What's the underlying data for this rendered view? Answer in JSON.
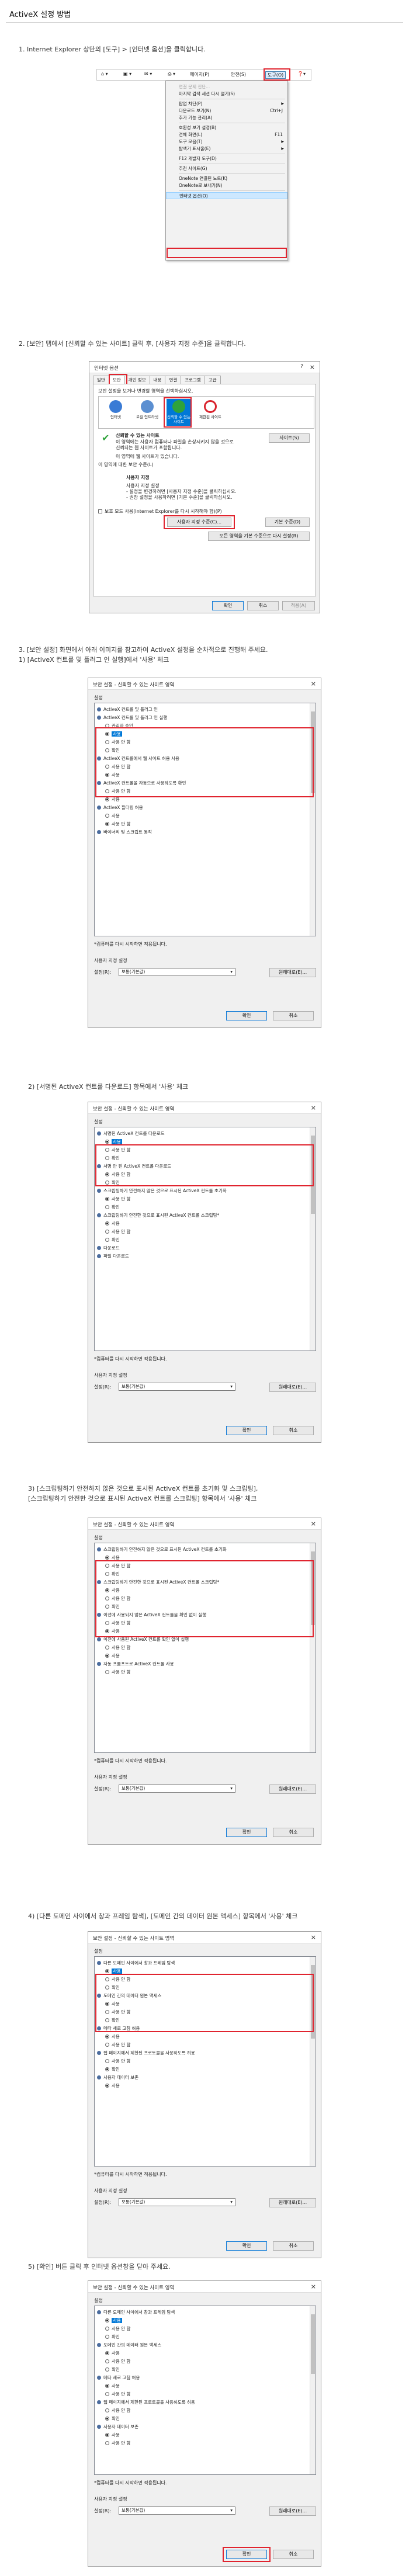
{
  "page": {
    "title": "ActiveX 설정 방법"
  },
  "steps": [
    "1. Internet Explorer 상단의 [도구] > [인터넷 옵션]을 클릭합니다.",
    "2. [보안] 탭에서 [신뢰할 수 있는 사이트] 클릭 후, [사용자 지정 수준]을 클릭합니다.",
    "3. [보안 설정] 화면에서 아래 이미지를 참고하여 ActiveX 설정을 순차적으로 진행해 주세요.\n   1) [ActiveX 컨트롤 및 플러그 인 실행]에서 '사용' 체크",
    "2) [서명된 ActiveX 컨트롤 다운로드] 항목에서 '사용' 체크",
    "3) [스크립팅하기 안전하지 않은 것으로 표시된 ActiveX 컨트롤 초기화 및 스크립팅],\n    [스크립팅하기 안전한 것으로 표시된 ActiveX 컨트롤 스크립팅] 항목에서 '사용' 체크",
    "4) [다른 도메인 사이에서 창과 프레임 탐색], [도메인 간의 데이터 원본 액세스] 항목에서 '사용' 체크",
    "5) [확인] 버튼 클릭 후 인터넷 옵션창을 닫아 주세요."
  ],
  "toolbar": {
    "items": [
      "페이지(P)",
      "안전(S)",
      "도구(O)"
    ],
    "active": "도구(O)"
  },
  "tools_menu": {
    "items": [
      {
        "label": "연결 문제 진단...",
        "shortcut": "",
        "disabled": true
      },
      {
        "label": "마지막 검색 세션 다시 열기(S)",
        "shortcut": "",
        "disabled": false
      },
      {
        "label": "",
        "sep": true
      },
      {
        "label": "팝업 차단(P)",
        "shortcut": "",
        "disabled": false,
        "arrow": true
      },
      {
        "label": "다운로드 보기(N)",
        "shortcut": "Ctrl+J",
        "disabled": false
      },
      {
        "label": "추가 기능 관리(A)",
        "shortcut": "",
        "disabled": false
      },
      {
        "label": "",
        "sep": true
      },
      {
        "label": "호환성 보기 설정(B)",
        "shortcut": "",
        "disabled": false
      },
      {
        "label": "전체 화면(L)",
        "shortcut": "F11",
        "disabled": false
      },
      {
        "label": "도구 모음(T)",
        "shortcut": "",
        "disabled": false,
        "arrow": true
      },
      {
        "label": "탐색기 표시줄(E)",
        "shortcut": "",
        "disabled": false,
        "arrow": true
      },
      {
        "label": "",
        "sep": true
      },
      {
        "label": "F12 개발자 도구(D)",
        "shortcut": "",
        "disabled": false
      },
      {
        "label": "",
        "sep": true
      },
      {
        "label": "추천 사이트(G)",
        "shortcut": "",
        "disabled": false
      },
      {
        "label": "",
        "sep": true
      },
      {
        "label": "OneNote 연결된 노트(K)",
        "shortcut": "",
        "disabled": false
      },
      {
        "label": "OneNote로 보내기(N)",
        "shortcut": "",
        "disabled": false
      },
      {
        "label": "",
        "sep": true
      },
      {
        "label": "인터넷 옵션(O)",
        "shortcut": "",
        "disabled": false,
        "highlight": true
      }
    ]
  },
  "internet_options": {
    "title": "인터넷 옵션",
    "help": "?",
    "close": "×",
    "tabs": [
      "일반",
      "보안",
      "개인 정보",
      "내용",
      "연결",
      "프로그램",
      "고급"
    ],
    "active_tab": "보안",
    "prompt": "보안 설정을 보거나 변경할 영역을 선택하십시오.",
    "zones": [
      {
        "label": "인터넷",
        "color": "#3a7bd5"
      },
      {
        "label": "로컬 인트라넷",
        "color": "#5b8fd1"
      },
      {
        "label": "신뢰할 수 있는 사이트",
        "color": "#2fa33b"
      },
      {
        "label": "제한된 사이트",
        "color": "#d9232d"
      }
    ],
    "selected_zone": "신뢰할 수 있는 사이트",
    "zone_heading": "신뢰할 수 있는 사이트",
    "zone_desc": "이 영역에는 사용자 컴퓨터나 파일을 손상시키지 않을 것으로 신뢰되는 웹 사이트가 포함됩니다.",
    "zone_desc2": "이 영역에 웹 사이트가 있습니다.",
    "sites_button": "사이트(S)",
    "level_heading": "이 영역에 대한 보안 수준(L)",
    "custom_title": "사용자 지정",
    "custom_lines": [
      "사용자 지정 설정",
      "- 설정을 변경하려면 [사용자 지정 수준]을 클릭하십시오.",
      "- 권장 설정을 사용하려면 [기본 수준]을 클릭하십시오."
    ],
    "protected_mode": "보호 모드 사용(Internet Explorer를 다시 시작해야 함)(P)",
    "custom_level_button": "사용자 지정 수준(C)...",
    "default_level_button": "기본 수준(D)",
    "reset_all_button": "모든 영역을 기본 수준으로 다시 설정(R)",
    "ok": "확인",
    "cancel": "취소",
    "apply": "적용(A)"
  },
  "security_dialog": {
    "title": "보안 설정 - 신뢰할 수 있는 사이트 영역",
    "close": "×",
    "settings_label": "설정",
    "note": "*컴퓨터를 다시 시작하면 적용됩니다.",
    "reset_label": "사용자 지정 설정",
    "reset_to_label": "설정(R):",
    "reset_value": "보통(기본값)",
    "reset_button": "원래대로(E)...",
    "ok": "확인",
    "cancel": "취소"
  },
  "settings_lists": [
    {
      "rows": [
        {
          "t": "h",
          "text": "ActiveX 컨트롤 및 플러그 인"
        },
        {
          "t": "c",
          "text": "ActiveX 컨트롤 및 플러그 인 실행"
        },
        {
          "t": "r",
          "text": "관리자 승인"
        },
        {
          "t": "r",
          "text": "사용",
          "on": true,
          "sel": true
        },
        {
          "t": "r",
          "text": "사용 안 함"
        },
        {
          "t": "r",
          "text": "확인"
        },
        {
          "t": "c",
          "text": "ActiveX 컨트롤에서 웹 사이트 허용 사용"
        },
        {
          "t": "r",
          "text": "사용 안 함"
        },
        {
          "t": "r",
          "text": "사용",
          "on": true
        },
        {
          "t": "c",
          "text": "ActiveX 컨트롤을 자동으로 사용하도록 확인"
        },
        {
          "t": "r",
          "text": "사용 안 함"
        },
        {
          "t": "r",
          "text": "사용",
          "on": true
        },
        {
          "t": "c",
          "text": "ActiveX 필터링 허용"
        },
        {
          "t": "r",
          "text": "사용"
        },
        {
          "t": "r",
          "text": "사용 안 함",
          "on": true
        },
        {
          "t": "c",
          "text": "바이너리 및 스크립트 동작"
        }
      ]
    },
    {
      "rows": [
        {
          "t": "c",
          "text": "서명된 ActiveX 컨트롤 다운로드"
        },
        {
          "t": "r",
          "text": "사용",
          "on": true,
          "sel": true
        },
        {
          "t": "r",
          "text": "사용 안 함"
        },
        {
          "t": "r",
          "text": "확인"
        },
        {
          "t": "c",
          "text": "서명 안 된 ActiveX 컨트롤 다운로드"
        },
        {
          "t": "r",
          "text": "사용 안 함",
          "on": true
        },
        {
          "t": "r",
          "text": "확인"
        },
        {
          "t": "c",
          "text": "스크립팅하기 안전하지 않은 것으로 표시된 ActiveX 컨트롤 초기화"
        },
        {
          "t": "r",
          "text": "사용 안 함",
          "on": true
        },
        {
          "t": "r",
          "text": "확인"
        },
        {
          "t": "c",
          "text": "스크립팅하기 안전한 것으로 표시된 ActiveX 컨트롤 스크립팅*"
        },
        {
          "t": "r",
          "text": "사용",
          "on": true
        },
        {
          "t": "r",
          "text": "사용 안 함"
        },
        {
          "t": "r",
          "text": "확인"
        },
        {
          "t": "c",
          "text": "다운로드"
        },
        {
          "t": "c",
          "text": "파일 다운로드"
        }
      ]
    },
    {
      "rows": [
        {
          "t": "c",
          "text": "스크립팅하기 안전하지 않은 것으로 표시된 ActiveX 컨트롤 초기화"
        },
        {
          "t": "r",
          "text": "사용",
          "on": true
        },
        {
          "t": "r",
          "text": "사용 안 함"
        },
        {
          "t": "r",
          "text": "확인"
        },
        {
          "t": "c",
          "text": "스크립팅하기 안전한 것으로 표시된 ActiveX 컨트롤 스크립팅*"
        },
        {
          "t": "r",
          "text": "사용",
          "on": true
        },
        {
          "t": "r",
          "text": "사용 안 함"
        },
        {
          "t": "r",
          "text": "확인"
        },
        {
          "t": "c",
          "text": "이전에 사용되지 않은 ActiveX 컨트롤을 확인 없이 실행"
        },
        {
          "t": "r",
          "text": "사용 안 함"
        },
        {
          "t": "r",
          "text": "사용",
          "on": true
        },
        {
          "t": "c",
          "text": "이전에 사용된 ActiveX 컨트롤 확인 없이 실행"
        },
        {
          "t": "r",
          "text": "사용 안 함"
        },
        {
          "t": "r",
          "text": "사용",
          "on": true
        },
        {
          "t": "c",
          "text": "자동 프롬프트로 ActiveX 컨트롤 사용"
        },
        {
          "t": "r",
          "text": "사용 안 함"
        }
      ]
    },
    {
      "rows": [
        {
          "t": "c",
          "text": "다른 도메인 사이에서 창과 프레임 탐색"
        },
        {
          "t": "r",
          "text": "사용",
          "on": true,
          "sel": true
        },
        {
          "t": "r",
          "text": "사용 안 함"
        },
        {
          "t": "r",
          "text": "확인"
        },
        {
          "t": "c",
          "text": "도메인 간의 데이터 원본 액세스"
        },
        {
          "t": "r",
          "text": "사용",
          "on": true
        },
        {
          "t": "r",
          "text": "사용 안 함"
        },
        {
          "t": "r",
          "text": "확인"
        },
        {
          "t": "c",
          "text": "메타 새로 고침 허용"
        },
        {
          "t": "r",
          "text": "사용",
          "on": true
        },
        {
          "t": "r",
          "text": "사용 안 함"
        },
        {
          "t": "c",
          "text": "웹 페이지에서 제한된 프로토콜을 사용하도록 허용"
        },
        {
          "t": "r",
          "text": "사용 안 함"
        },
        {
          "t": "r",
          "text": "확인",
          "on": true
        },
        {
          "t": "c",
          "text": "사용자 데이터 보존"
        },
        {
          "t": "r",
          "text": "사용",
          "on": true
        }
      ]
    },
    {
      "rows": [
        {
          "t": "c",
          "text": "다른 도메인 사이에서 창과 프레임 탐색"
        },
        {
          "t": "r",
          "text": "사용",
          "on": true,
          "sel": true
        },
        {
          "t": "r",
          "text": "사용 안 함"
        },
        {
          "t": "r",
          "text": "확인"
        },
        {
          "t": "c",
          "text": "도메인 간의 데이터 원본 액세스"
        },
        {
          "t": "r",
          "text": "사용",
          "on": true
        },
        {
          "t": "r",
          "text": "사용 안 함"
        },
        {
          "t": "r",
          "text": "확인"
        },
        {
          "t": "c",
          "text": "메타 새로 고침 허용"
        },
        {
          "t": "r",
          "text": "사용",
          "on": true
        },
        {
          "t": "r",
          "text": "사용 안 함"
        },
        {
          "t": "c",
          "text": "웹 페이지에서 제한된 프로토콜을 사용하도록 허용"
        },
        {
          "t": "r",
          "text": "사용 안 함"
        },
        {
          "t": "r",
          "text": "확인",
          "on": true
        },
        {
          "t": "c",
          "text": "사용자 데이터 보존"
        },
        {
          "t": "r",
          "text": "사용",
          "on": true
        },
        {
          "t": "r",
          "text": "사용 안 함"
        }
      ]
    }
  ],
  "colors": {
    "highlight_border": "#e0242f",
    "selection": "#0078d7",
    "accent_button": "#0a78d7"
  }
}
